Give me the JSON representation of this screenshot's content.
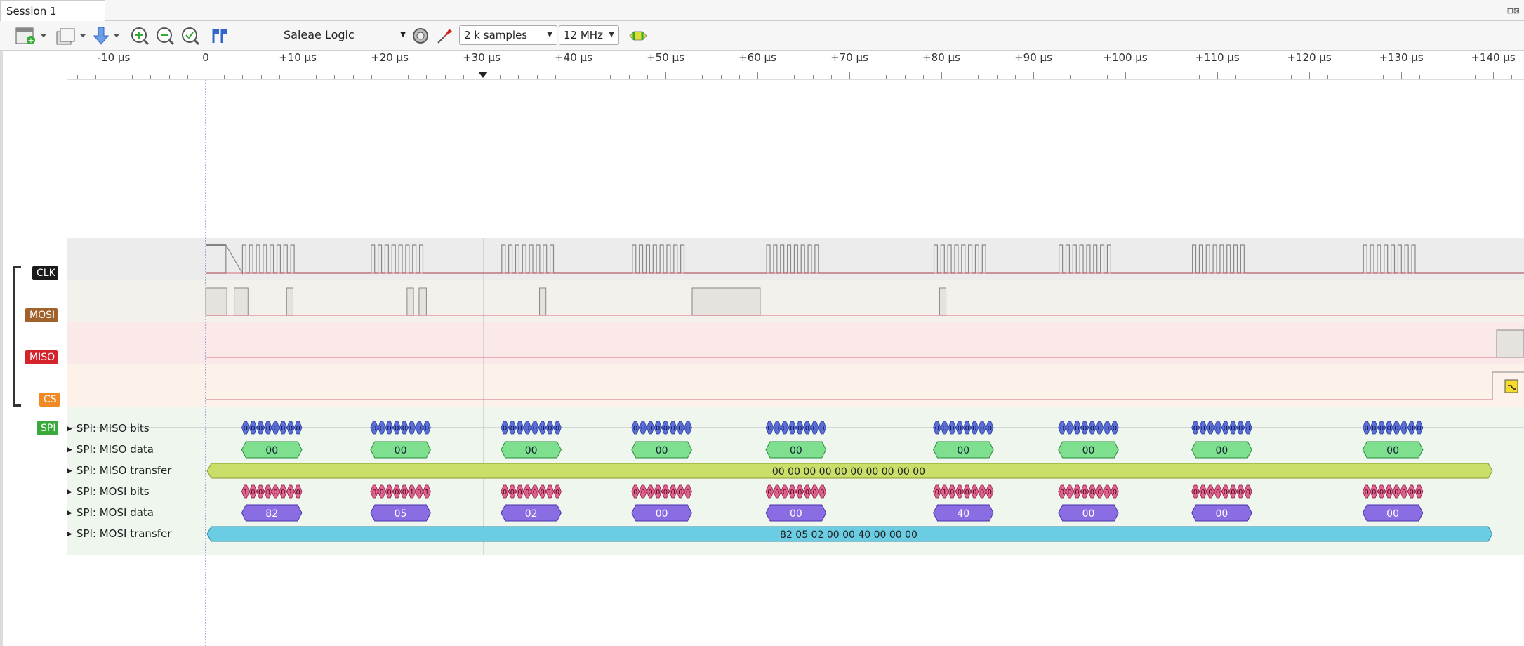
{
  "tab": {
    "title": "Session 1"
  },
  "toolbar": {
    "device": "Saleae Logic",
    "samples": "2 k samples",
    "rate": "12 MHz"
  },
  "ruler": {
    "labels": [
      "-10 µs",
      "0",
      "+10 µs",
      "+20 µs",
      "+30 µs",
      "+40 µs",
      "+50 µs",
      "+60 µs",
      "+70 µs",
      "+80 µs",
      "+90 µs",
      "+100 µs",
      "+110 µs",
      "+120 µs",
      "+130 µs",
      "+140 µs"
    ]
  },
  "channels": {
    "clk": "CLK",
    "mosi": "MOSI",
    "miso": "MISO",
    "cs": "CS",
    "spi": "SPI"
  },
  "analyzer_rows": {
    "miso_bits": "SPI: MISO bits",
    "miso_data": "SPI: MISO data",
    "miso_transfer": "SPI: MISO transfer",
    "mosi_bits": "SPI: MOSI bits",
    "mosi_data": "SPI: MOSI data",
    "mosi_transfer": "SPI: MOSI transfer"
  },
  "decoded": {
    "miso_data": [
      "00",
      "00",
      "00",
      "00",
      "00",
      "00",
      "00",
      "00",
      "00"
    ],
    "miso_transfer": "00 00 00 00 00 00 00 00 00 00",
    "mosi_data": [
      "82",
      "05",
      "02",
      "00",
      "00",
      "40",
      "00",
      "00",
      "00"
    ],
    "mosi_transfer": "82 05 02 00 00 40 00 00 00",
    "mosi_bits": [
      [
        "1",
        "0",
        "0",
        "0",
        "0",
        "0",
        "1",
        "0"
      ],
      [
        "0",
        "0",
        "0",
        "0",
        "0",
        "1",
        "0",
        "1"
      ],
      [
        "0",
        "0",
        "0",
        "0",
        "0",
        "0",
        "1",
        "0"
      ],
      [
        "0",
        "0",
        "0",
        "0",
        "0",
        "0",
        "0",
        "0"
      ],
      [
        "0",
        "0",
        "0",
        "0",
        "0",
        "0",
        "0",
        "0"
      ],
      [
        "0",
        "1",
        "0",
        "0",
        "0",
        "0",
        "0",
        "0"
      ],
      [
        "0",
        "0",
        "0",
        "0",
        "0",
        "0",
        "0",
        "0"
      ],
      [
        "0",
        "0",
        "0",
        "0",
        "0",
        "0",
        "0",
        "0"
      ],
      [
        "0",
        "0",
        "0",
        "0",
        "0",
        "0",
        "0",
        "0"
      ]
    ],
    "miso_bits": [
      [
        "0",
        "0",
        "0",
        "0",
        "0",
        "0",
        "0",
        "0"
      ],
      [
        "0",
        "0",
        "0",
        "0",
        "0",
        "0",
        "0",
        "0"
      ],
      [
        "0",
        "0",
        "0",
        "0",
        "0",
        "0",
        "0",
        "0"
      ],
      [
        "0",
        "0",
        "0",
        "0",
        "0",
        "0",
        "0",
        "0"
      ],
      [
        "0",
        "0",
        "0",
        "0",
        "0",
        "0",
        "0",
        "0"
      ],
      [
        "0",
        "0",
        "0",
        "0",
        "0",
        "0",
        "0",
        "0"
      ],
      [
        "0",
        "0",
        "0",
        "0",
        "0",
        "0",
        "0",
        "0"
      ],
      [
        "0",
        "0",
        "0",
        "0",
        "0",
        "0",
        "0",
        "0"
      ],
      [
        "0",
        "0",
        "0",
        "0",
        "0",
        "0",
        "0",
        "0"
      ]
    ]
  },
  "colors": {
    "clk": "#1a1a1a",
    "mosi": "#a0622a",
    "miso": "#d3232b",
    "cs": "#f08a24",
    "spi": "#3aaa3a",
    "bits_miso": "#5b6fd6",
    "bits_mosi": "#e2658f",
    "data_miso": "#7ee08f",
    "data_mosi": "#8a6de3",
    "transfer_miso": "#c8e06a",
    "transfer_mosi": "#6bcde3"
  }
}
